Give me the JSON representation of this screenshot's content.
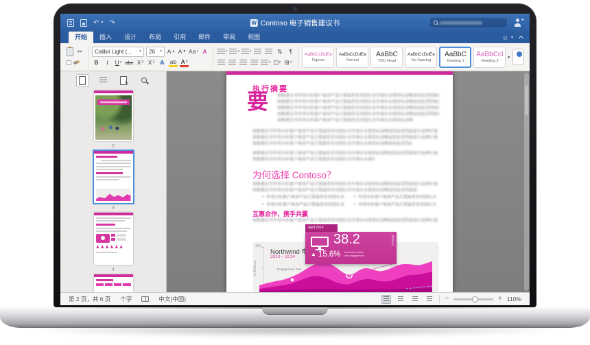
{
  "titlebar": {
    "title": "Contoso 电子销售建议书"
  },
  "tabs": [
    {
      "label": "开始"
    },
    {
      "label": "插入"
    },
    {
      "label": "设计"
    },
    {
      "label": "布局"
    },
    {
      "label": "引用"
    },
    {
      "label": "邮件"
    },
    {
      "label": "审阅"
    },
    {
      "label": "视图"
    }
  ],
  "icons": {
    "word": "W",
    "undo": "↶",
    "redo": "↷",
    "caret": "▾",
    "scissors": "✂",
    "smiley": "☺",
    "pilcrow": "¶",
    "sort": "⇅",
    "borders": "⊞",
    "more": "▸",
    "bullet_person": "♟",
    "minus": "−",
    "plus": "+",
    "up_arrow": "▲",
    "share_plus": "+"
  },
  "ribbon": {
    "font_name": "Calibri Light (...",
    "font_size": "26",
    "bold": "B",
    "italic": "I",
    "underline": "U",
    "strike": "abc",
    "subscript": "X",
    "subscript_sub": "2",
    "superscript": "X",
    "superscript_sup": "2",
    "grow_font": "A",
    "shrink_font": "A",
    "change_case": "Aa",
    "clear_format": "A",
    "text_effects": "A",
    "highlight": "ab",
    "font_color": "A",
    "styles": [
      {
        "sample": "AaBbCcDdEe",
        "name": "Figures"
      },
      {
        "sample": "AaBbCcDdEe",
        "name": "Normal"
      },
      {
        "sample": "AaBbC",
        "name": "TOC Head"
      },
      {
        "sample": "AaBbCcDdEe",
        "name": "No Spacing"
      },
      {
        "sample": "AaBbC",
        "name": "Heading 1"
      },
      {
        "sample": "AaBbCcI",
        "name": "Heading 2"
      }
    ]
  },
  "sidebar": {
    "page_labels": [
      "2",
      "3",
      "4"
    ]
  },
  "doc": {
    "heading1": "执行摘要",
    "dropcap": "要",
    "heading2": "为何选择 Contoso？",
    "heading3": "互惠合作，携手共赢",
    "filler": "销售建议书市场分析客户需求产品方案服务支持团队合作增长业绩目标战略规划投资回报提升品牌价值创新技术平台整合资源优化流程管理体系全面推进发展方向销售建议书市场分析客户需求",
    "filler_short": "市场分析客户需求产品方案服务支持团队合作"
  },
  "chart": {
    "title": "Northwind 电视销售额增加",
    "subtitle": "2010 – 2014",
    "ytick_top": "100",
    "ylabel": "in Millions",
    "annotation": "Engagement start",
    "callout_date": "April 2014",
    "callout_value": "38.2",
    "callout_unit": "Million",
    "callout_delta": "15.6%",
    "callout_note1": "Increase in sales",
    "callout_note2": "post engagement"
  },
  "statusbar": {
    "page": "第 2 页，共 6 页",
    "words": "个字",
    "language": "中文(中国)",
    "zoom": "110%"
  },
  "colors": {
    "accent_pink": "#d6379e",
    "titlebar_blue": "#2b5c9f",
    "selection_blue": "#4a90d9"
  }
}
